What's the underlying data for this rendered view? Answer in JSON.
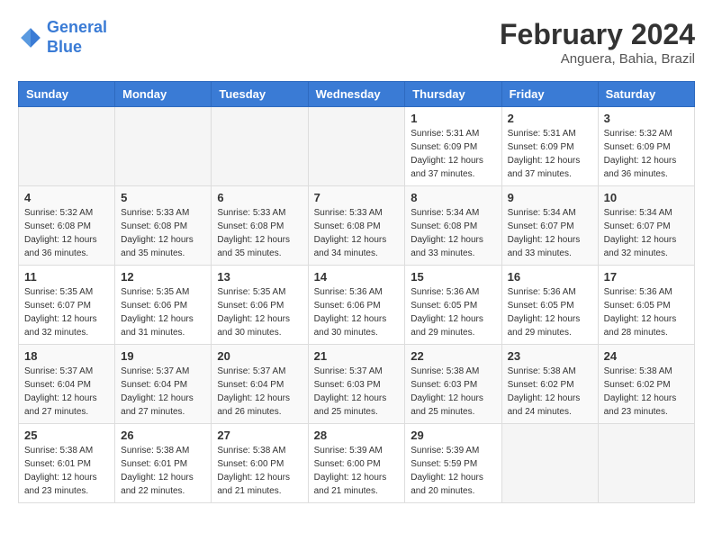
{
  "header": {
    "logo_general": "General",
    "logo_blue": "Blue",
    "month_year": "February 2024",
    "location": "Anguera, Bahia, Brazil"
  },
  "days_of_week": [
    "Sunday",
    "Monday",
    "Tuesday",
    "Wednesday",
    "Thursday",
    "Friday",
    "Saturday"
  ],
  "weeks": [
    [
      {
        "day": "",
        "info": ""
      },
      {
        "day": "",
        "info": ""
      },
      {
        "day": "",
        "info": ""
      },
      {
        "day": "",
        "info": ""
      },
      {
        "day": "1",
        "info": "Sunrise: 5:31 AM\nSunset: 6:09 PM\nDaylight: 12 hours\nand 37 minutes."
      },
      {
        "day": "2",
        "info": "Sunrise: 5:31 AM\nSunset: 6:09 PM\nDaylight: 12 hours\nand 37 minutes."
      },
      {
        "day": "3",
        "info": "Sunrise: 5:32 AM\nSunset: 6:09 PM\nDaylight: 12 hours\nand 36 minutes."
      }
    ],
    [
      {
        "day": "4",
        "info": "Sunrise: 5:32 AM\nSunset: 6:08 PM\nDaylight: 12 hours\nand 36 minutes."
      },
      {
        "day": "5",
        "info": "Sunrise: 5:33 AM\nSunset: 6:08 PM\nDaylight: 12 hours\nand 35 minutes."
      },
      {
        "day": "6",
        "info": "Sunrise: 5:33 AM\nSunset: 6:08 PM\nDaylight: 12 hours\nand 35 minutes."
      },
      {
        "day": "7",
        "info": "Sunrise: 5:33 AM\nSunset: 6:08 PM\nDaylight: 12 hours\nand 34 minutes."
      },
      {
        "day": "8",
        "info": "Sunrise: 5:34 AM\nSunset: 6:08 PM\nDaylight: 12 hours\nand 33 minutes."
      },
      {
        "day": "9",
        "info": "Sunrise: 5:34 AM\nSunset: 6:07 PM\nDaylight: 12 hours\nand 33 minutes."
      },
      {
        "day": "10",
        "info": "Sunrise: 5:34 AM\nSunset: 6:07 PM\nDaylight: 12 hours\nand 32 minutes."
      }
    ],
    [
      {
        "day": "11",
        "info": "Sunrise: 5:35 AM\nSunset: 6:07 PM\nDaylight: 12 hours\nand 32 minutes."
      },
      {
        "day": "12",
        "info": "Sunrise: 5:35 AM\nSunset: 6:06 PM\nDaylight: 12 hours\nand 31 minutes."
      },
      {
        "day": "13",
        "info": "Sunrise: 5:35 AM\nSunset: 6:06 PM\nDaylight: 12 hours\nand 30 minutes."
      },
      {
        "day": "14",
        "info": "Sunrise: 5:36 AM\nSunset: 6:06 PM\nDaylight: 12 hours\nand 30 minutes."
      },
      {
        "day": "15",
        "info": "Sunrise: 5:36 AM\nSunset: 6:05 PM\nDaylight: 12 hours\nand 29 minutes."
      },
      {
        "day": "16",
        "info": "Sunrise: 5:36 AM\nSunset: 6:05 PM\nDaylight: 12 hours\nand 29 minutes."
      },
      {
        "day": "17",
        "info": "Sunrise: 5:36 AM\nSunset: 6:05 PM\nDaylight: 12 hours\nand 28 minutes."
      }
    ],
    [
      {
        "day": "18",
        "info": "Sunrise: 5:37 AM\nSunset: 6:04 PM\nDaylight: 12 hours\nand 27 minutes."
      },
      {
        "day": "19",
        "info": "Sunrise: 5:37 AM\nSunset: 6:04 PM\nDaylight: 12 hours\nand 27 minutes."
      },
      {
        "day": "20",
        "info": "Sunrise: 5:37 AM\nSunset: 6:04 PM\nDaylight: 12 hours\nand 26 minutes."
      },
      {
        "day": "21",
        "info": "Sunrise: 5:37 AM\nSunset: 6:03 PM\nDaylight: 12 hours\nand 25 minutes."
      },
      {
        "day": "22",
        "info": "Sunrise: 5:38 AM\nSunset: 6:03 PM\nDaylight: 12 hours\nand 25 minutes."
      },
      {
        "day": "23",
        "info": "Sunrise: 5:38 AM\nSunset: 6:02 PM\nDaylight: 12 hours\nand 24 minutes."
      },
      {
        "day": "24",
        "info": "Sunrise: 5:38 AM\nSunset: 6:02 PM\nDaylight: 12 hours\nand 23 minutes."
      }
    ],
    [
      {
        "day": "25",
        "info": "Sunrise: 5:38 AM\nSunset: 6:01 PM\nDaylight: 12 hours\nand 23 minutes."
      },
      {
        "day": "26",
        "info": "Sunrise: 5:38 AM\nSunset: 6:01 PM\nDaylight: 12 hours\nand 22 minutes."
      },
      {
        "day": "27",
        "info": "Sunrise: 5:38 AM\nSunset: 6:00 PM\nDaylight: 12 hours\nand 21 minutes."
      },
      {
        "day": "28",
        "info": "Sunrise: 5:39 AM\nSunset: 6:00 PM\nDaylight: 12 hours\nand 21 minutes."
      },
      {
        "day": "29",
        "info": "Sunrise: 5:39 AM\nSunset: 5:59 PM\nDaylight: 12 hours\nand 20 minutes."
      },
      {
        "day": "",
        "info": ""
      },
      {
        "day": "",
        "info": ""
      }
    ]
  ]
}
